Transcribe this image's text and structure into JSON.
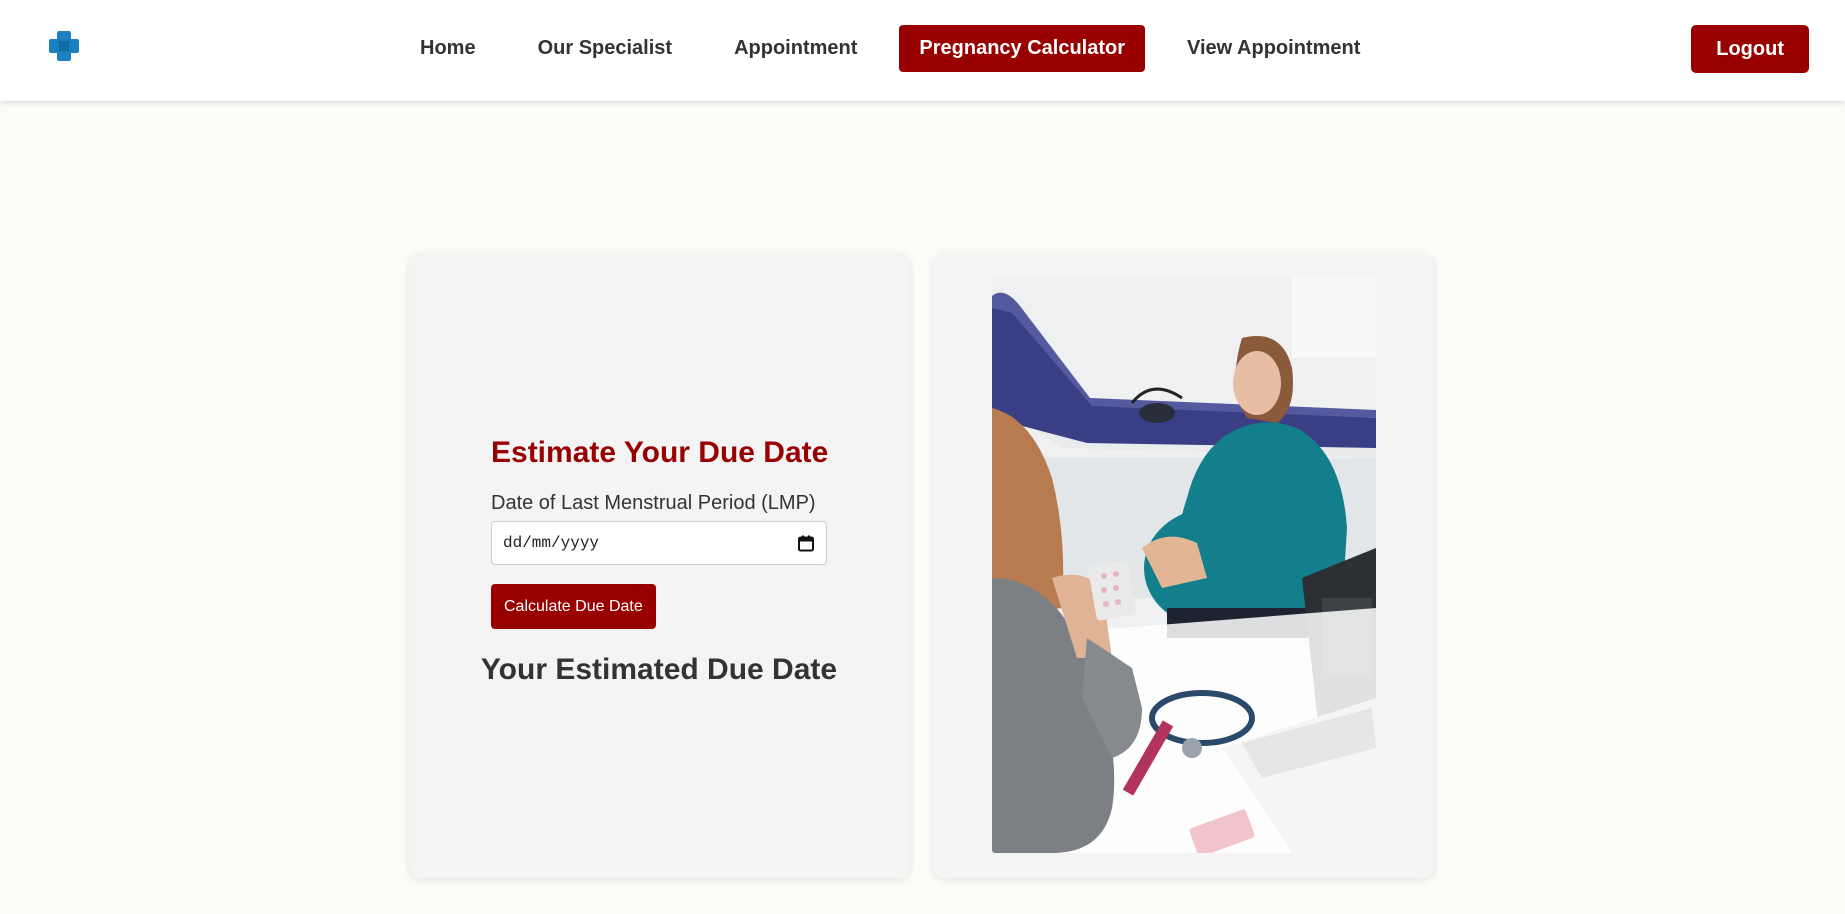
{
  "nav": {
    "logo_icon": "medical-cross-icon",
    "links": [
      {
        "label": "Home"
      },
      {
        "label": "Our Specialist"
      },
      {
        "label": "Appointment"
      },
      {
        "label": "Pregnancy Calculator"
      },
      {
        "label": "View Appointment"
      }
    ],
    "active_index": 3,
    "logout_label": "Logout"
  },
  "calculator": {
    "title": "Estimate Your Due Date",
    "lmp_label": "Date of Last Menstrual Period (LMP)",
    "date_placeholder": "dd/mm/yyyy",
    "calendar_icon": "calendar-icon",
    "button_label": "Calculate Due Date",
    "result_heading": "Your Estimated Due Date"
  },
  "photo": {
    "subject": "pregnant woman consulting with a doctor"
  },
  "colors": {
    "accent": "#990000",
    "logo_blue": "#1a7fc1",
    "page_bg": "#fcfbf7",
    "card_bg": "#f4f4f4",
    "text": "#333333"
  }
}
